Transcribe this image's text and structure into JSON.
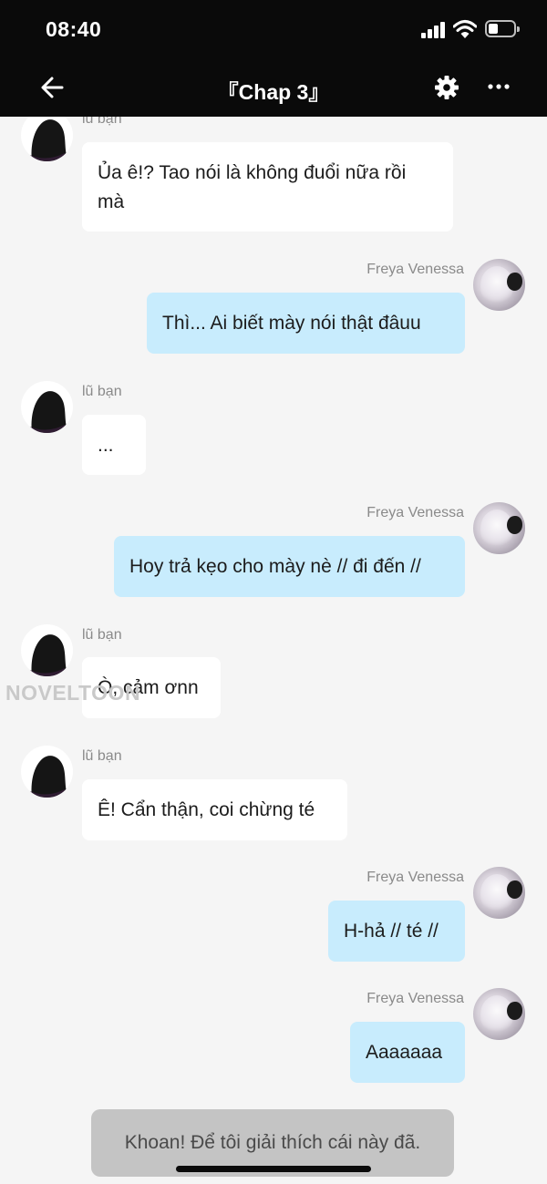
{
  "status_bar": {
    "time": "08:40"
  },
  "header": {
    "title": "『Chap 3』",
    "icons": [
      "back-arrow-icon",
      "gear-icon",
      "more-dots-icon"
    ]
  },
  "messages": [
    {
      "sender": "lũ bạn",
      "side": "left",
      "text": "Ủa ê!? Tao nói là không đuổi nữa rồi mà"
    },
    {
      "sender": "Freya Venessa",
      "side": "right",
      "text": "Thì... Ai biết mày nói thật đâuu"
    },
    {
      "sender": "lũ bạn",
      "side": "left",
      "text": "..."
    },
    {
      "sender": "Freya Venessa",
      "side": "right",
      "text": "Hoy trả kẹo cho mày nè // đi đến //"
    },
    {
      "sender": "lũ bạn",
      "side": "left",
      "text": "Ò, cảm ơnn"
    },
    {
      "sender": "lũ bạn",
      "side": "left",
      "text": "Ê! Cẩn thận, coi chừng té"
    },
    {
      "sender": "Freya Venessa",
      "side": "right",
      "text": "H-hả // té //"
    },
    {
      "sender": "Freya Venessa",
      "side": "right",
      "text": "Aaaaaaa"
    }
  ],
  "narration": "Khoan! Để tôi giải thích cái này đã.",
  "watermark": "NOVELTOON",
  "colors": {
    "header_bg": "#0a0a0a",
    "incoming_bubble": "#ffffff",
    "outgoing_bubble": "#c8ecfd",
    "narration_bg": "#c4c4c4"
  }
}
